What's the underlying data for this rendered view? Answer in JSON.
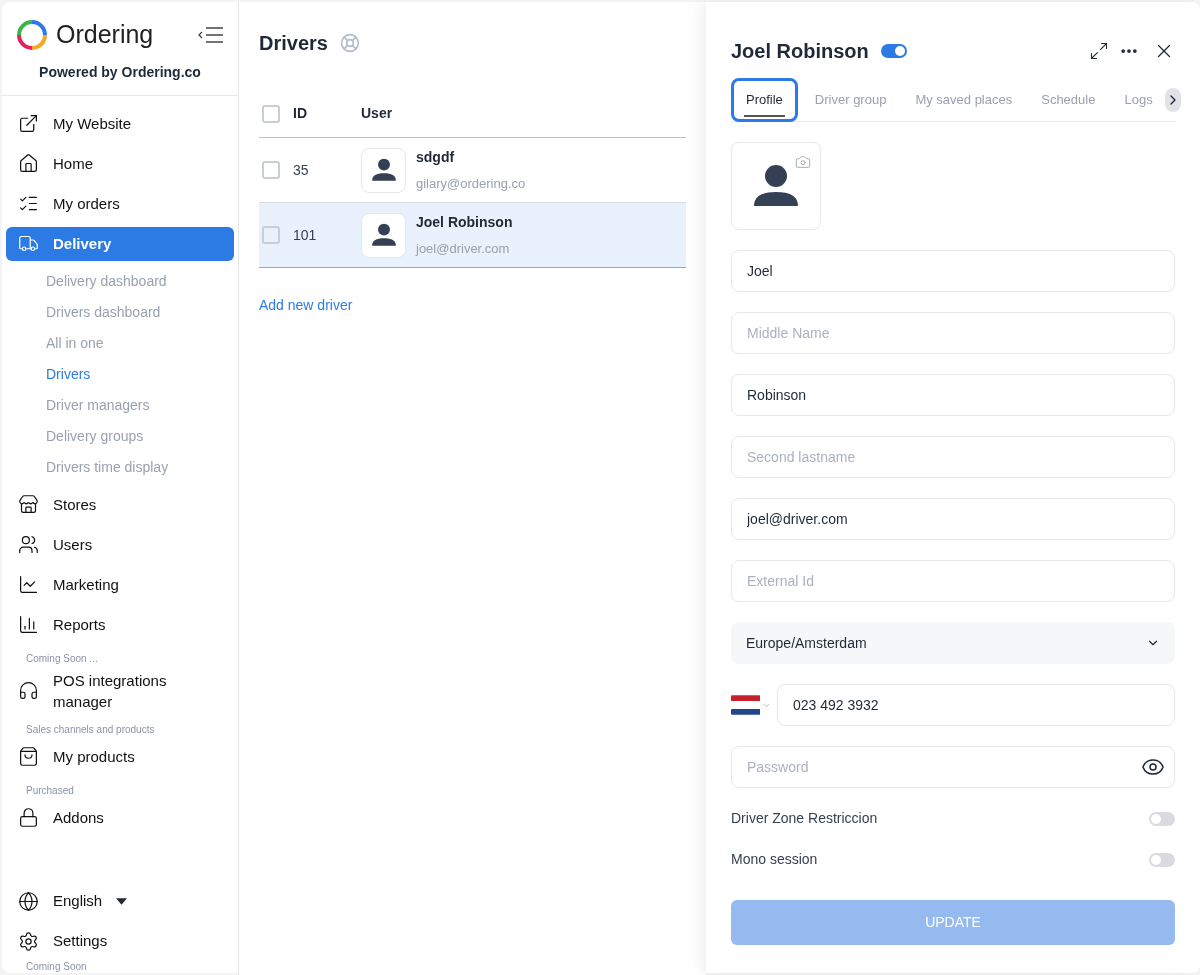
{
  "brand": {
    "name": "Ordering",
    "powered_by": "Powered by Ordering.co"
  },
  "nav": [
    {
      "kind": "item",
      "label": "My Website",
      "selected": false
    },
    {
      "kind": "item",
      "label": "Home",
      "selected": false
    },
    {
      "kind": "item",
      "label": "My orders",
      "selected": false
    },
    {
      "kind": "item",
      "label": "Delivery",
      "selected": true,
      "children": [
        {
          "label": "Delivery dashboard",
          "selected": false
        },
        {
          "label": "Drivers dashboard",
          "selected": false
        },
        {
          "label": "All in one",
          "selected": false
        },
        {
          "label": "Drivers",
          "selected": true
        },
        {
          "label": "Driver managers",
          "selected": false
        },
        {
          "label": "Delivery groups",
          "selected": false
        },
        {
          "label": "Drivers time display",
          "selected": false
        }
      ]
    },
    {
      "kind": "item",
      "label": "Stores",
      "selected": false
    },
    {
      "kind": "item",
      "label": "Users",
      "selected": false
    },
    {
      "kind": "item",
      "label": "Marketing",
      "selected": false
    },
    {
      "kind": "item",
      "label": "Reports",
      "selected": false
    },
    {
      "kind": "heading",
      "label": "Coming Soon ..."
    },
    {
      "kind": "item",
      "label": "POS integrations manager",
      "selected": false
    },
    {
      "kind": "heading",
      "label": "Sales channels and products"
    },
    {
      "kind": "item",
      "label": "My products",
      "selected": false
    },
    {
      "kind": "heading",
      "label": "Purchased"
    },
    {
      "kind": "item",
      "label": "Addons",
      "selected": false
    }
  ],
  "footer_nav": [
    {
      "kind": "language",
      "label": "English"
    },
    {
      "kind": "item",
      "label": "Settings"
    },
    {
      "kind": "heading",
      "label": "Coming Soon"
    }
  ],
  "page": {
    "title": "Drivers",
    "columns": [
      "ID",
      "User"
    ],
    "select_all_checked": false,
    "rows": [
      {
        "id": "35",
        "name": "sdgdf",
        "email": "gilary@ordering.co",
        "checked": false,
        "selected": false
      },
      {
        "id": "101",
        "name": "Joel Robinson",
        "email": "joel@driver.com",
        "checked": false,
        "selected": true
      }
    ],
    "add_link": "Add new driver"
  },
  "drawer": {
    "title": "Joel Robinson",
    "active": true,
    "tabs": [
      {
        "label": "Profile",
        "selected": true
      },
      {
        "label": "Driver group",
        "selected": false
      },
      {
        "label": "My saved places",
        "selected": false
      },
      {
        "label": "Schedule",
        "selected": false
      },
      {
        "label": "Logs",
        "selected": false
      }
    ],
    "fields": [
      {
        "kind": "text",
        "value": "Joel"
      },
      {
        "kind": "text",
        "placeholder": "Middle Name"
      },
      {
        "kind": "text",
        "value": "Robinson"
      },
      {
        "kind": "text",
        "placeholder": "Second lastname"
      },
      {
        "kind": "text",
        "value": "joel@driver.com"
      },
      {
        "kind": "text",
        "placeholder": "External Id"
      },
      {
        "kind": "select",
        "value": "Europe/Amsterdam"
      },
      {
        "kind": "phone",
        "value": "023 492 3932"
      },
      {
        "kind": "password",
        "placeholder": "Password"
      }
    ],
    "toggles": [
      {
        "label": "Driver Zone Restriccion",
        "on": false
      },
      {
        "label": "Mono session",
        "on": false
      }
    ],
    "submit": {
      "label": "UPDATE",
      "disabled": true
    }
  }
}
